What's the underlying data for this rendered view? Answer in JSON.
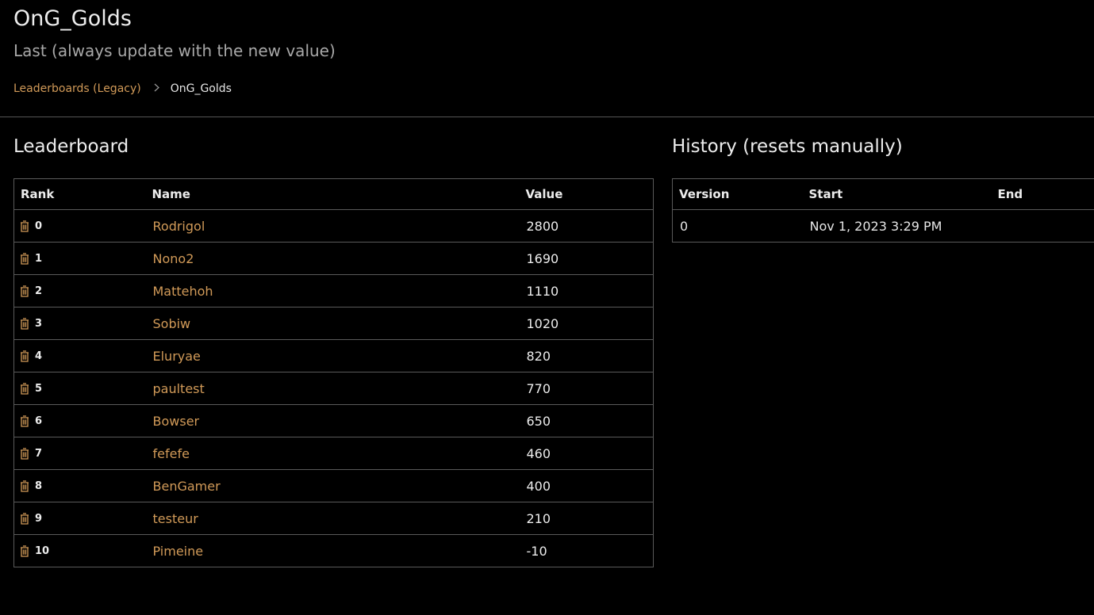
{
  "page": {
    "title": "OnG_Golds",
    "subtitle": "Last (always update with the new value)"
  },
  "breadcrumb": {
    "parent": "Leaderboards (Legacy)",
    "current": "OnG_Golds"
  },
  "leaderboard": {
    "title": "Leaderboard",
    "columns": [
      "Rank",
      "Name",
      "Value"
    ],
    "rows": [
      {
        "rank": "0",
        "name": "Rodrigol",
        "value": "2800"
      },
      {
        "rank": "1",
        "name": "Nono2",
        "value": "1690"
      },
      {
        "rank": "2",
        "name": "Mattehoh",
        "value": "1110"
      },
      {
        "rank": "3",
        "name": "Sobiw",
        "value": "1020"
      },
      {
        "rank": "4",
        "name": "Eluryae",
        "value": "820"
      },
      {
        "rank": "5",
        "name": "paultest",
        "value": "770"
      },
      {
        "rank": "6",
        "name": "Bowser",
        "value": "650"
      },
      {
        "rank": "7",
        "name": "fefefe",
        "value": "460"
      },
      {
        "rank": "8",
        "name": "BenGamer",
        "value": "400"
      },
      {
        "rank": "9",
        "name": "testeur",
        "value": "210"
      },
      {
        "rank": "10",
        "name": "Pimeine",
        "value": "-10"
      }
    ]
  },
  "history": {
    "title": "History (resets manually)",
    "columns": [
      "Version",
      "Start",
      "End"
    ],
    "rows": [
      {
        "version": "0",
        "start": "Nov 1, 2023 3:29 PM",
        "end": ""
      }
    ]
  },
  "colors": {
    "accent": "#d19a58",
    "background": "#000000"
  },
  "icons": {
    "row_action": "trash-icon",
    "breadcrumb_separator": "chevron-right-icon"
  }
}
